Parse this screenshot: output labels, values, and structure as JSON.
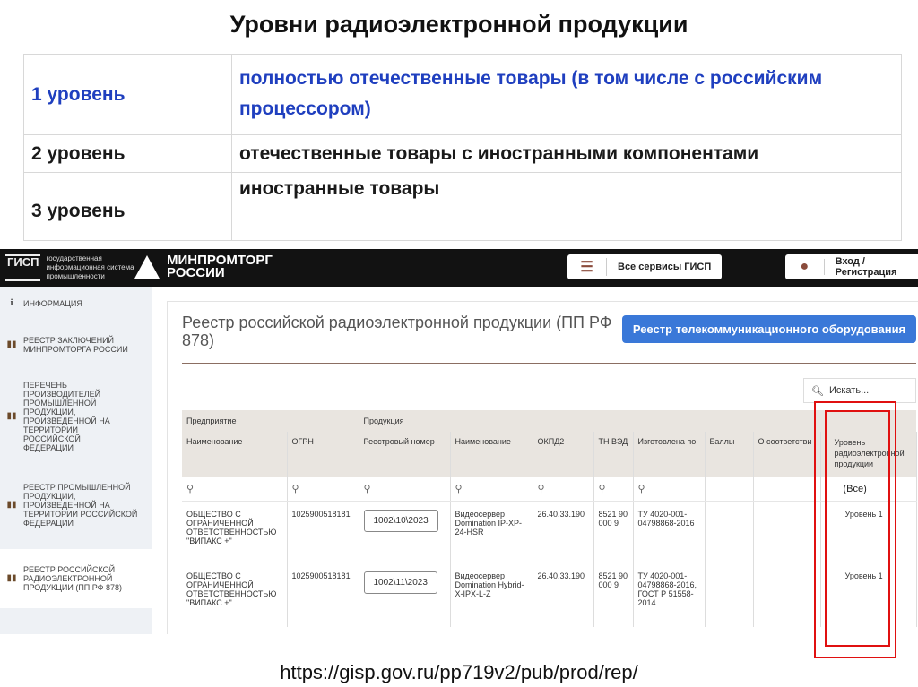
{
  "slide": {
    "title": "Уровни радиоэлектронной продукции",
    "url": "https://gisp.gov.ru/pp719v2/pub/prod/rep/"
  },
  "levels": [
    {
      "level": "1 уровень",
      "desc": "полностью отечественные товары (в том числе с российским процессором)",
      "color": "#1f3fbf"
    },
    {
      "level": "2 уровень",
      "desc": "отечественные товары с иностранными компонентами"
    },
    {
      "level": "3 уровень",
      "desc": "иностранные товары"
    }
  ],
  "header": {
    "gisp_logo": "ГИСП",
    "gisp_text": [
      "государственная",
      "информационная система",
      "промышленности"
    ],
    "ministry": [
      "МИНПРОМТОРГ",
      "РОССИИ"
    ],
    "services_label": "Все сервисы ГИСП",
    "login_label": "Вход / Регистрация"
  },
  "sidebar": {
    "items": [
      {
        "label": "ИНФОРМАЦИЯ",
        "icon": "info-icon"
      },
      {
        "label": "РЕЕСТР ЗАКЛЮЧЕНИЙ МИНПРОМТОРГА РОССИИ",
        "icon": "book-icon"
      },
      {
        "label": "ПЕРЕЧЕНЬ ПРОИЗВОДИТЕЛЕЙ ПРОМЫШЛЕННОЙ ПРОДУКЦИИ, ПРОИЗВЕДЕННОЙ НА ТЕРРИТОРИИ РОССИЙСКОЙ ФЕДЕРАЦИИ",
        "icon": "book-icon"
      },
      {
        "label": "РЕЕСТР ПРОМЫШЛЕННОЙ ПРОДУКЦИИ, ПРОИЗВЕДЕННОЙ НА ТЕРРИТОРИИ РОССИЙСКОЙ ФЕДЕРАЦИИ",
        "icon": "book-icon"
      },
      {
        "label": "РЕЕСТР РОССИЙСКОЙ РАДИОЭЛЕКТРОННОЙ ПРОДУКЦИИ (ПП РФ 878)",
        "icon": "book-icon",
        "active": true
      }
    ]
  },
  "main": {
    "title": "Реестр российской радиоэлектронной продукции (ПП РФ 878)",
    "telecom_button": "Реестр телекоммуникационного оборудования",
    "search_placeholder": "Искать...",
    "groups": [
      "Предприятие",
      "Продукция"
    ],
    "columns": [
      "Наименование",
      "ОГРН",
      "Реестровый номер",
      "Наименование",
      "ОКПД2",
      "ТН ВЭД",
      "Изготовлена по",
      "Баллы",
      "О соответстви",
      "Уровень радиоэлектронной продукции"
    ],
    "level_filter": "(Все)",
    "rows": [
      {
        "company": "ОБЩЕСТВО С ОГРАНИЧЕННОЙ ОТВЕТСТВЕННОСТЬЮ \"ВИПАКС +\"",
        "ogrn": "1025900518181",
        "reg": "1002\\10\\2023",
        "name": "Видеосервер Domination IP-XP-24-HSR",
        "okpd": "26.40.33.190",
        "tnved": "8521 90 000 9",
        "made": "ТУ 4020-001-04798868-2016",
        "points": "",
        "conf": "",
        "level": "Уровень 1"
      },
      {
        "company": "ОБЩЕСТВО С ОГРАНИЧЕННОЙ ОТВЕТСТВЕННОСТЬЮ \"ВИПАКС +\"",
        "ogrn": "1025900518181",
        "reg": "1002\\11\\2023",
        "name": "Видеосервер Domination Hybrid-X-IPX-L-Z",
        "okpd": "26.40.33.190",
        "tnved": "8521 90 000 9",
        "made": "ТУ 4020-001-04798868-2016, ГОСТ Р 51558-2014",
        "points": "",
        "conf": "",
        "level": "Уровень 1"
      }
    ]
  },
  "highlight_color": "#e01010"
}
